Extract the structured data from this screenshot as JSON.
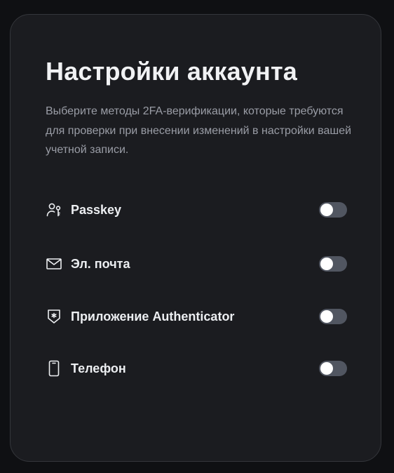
{
  "settings": {
    "title": "Настройки аккаунта",
    "description": "Выберите методы 2FA-верификации, которые требуются для проверки при внесении изменений в настройки вашей учетной записи.",
    "options": [
      {
        "label": "Passkey",
        "icon": "passkey-icon",
        "enabled": false
      },
      {
        "label": "Эл. почта",
        "icon": "mail-icon",
        "enabled": false
      },
      {
        "label": "Приложение Authenticator",
        "icon": "authenticator-icon",
        "enabled": false
      },
      {
        "label": "Телефон",
        "icon": "phone-icon",
        "enabled": false
      }
    ]
  },
  "colors": {
    "background": "#0f1013",
    "card": "#1b1c20",
    "toggle_off": "#515661",
    "text": "#eceef1",
    "muted_text": "#9a9da6"
  }
}
